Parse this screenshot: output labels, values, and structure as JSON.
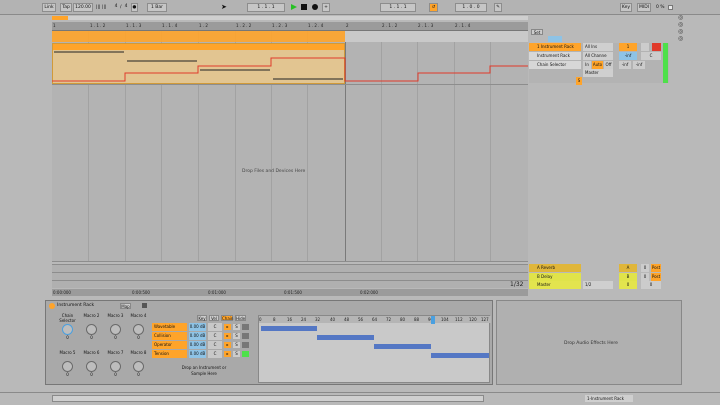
{
  "transport": {
    "link": "Link",
    "tap": "Tap",
    "tempo": "120.00",
    "sig_num": "4",
    "sig_den": "4",
    "quant": "1 Bar",
    "position": "1 . 1 . 1",
    "loop_start": "1 . 1 . 1",
    "loop_len": "1 . 0 . 0",
    "key": "Key",
    "midi": "MIDI",
    "cpu": "0 %"
  },
  "ruler": {
    "bars": [
      "1 . 1 . 2",
      "1 . 1 . 3",
      "1 . 1 . 4",
      "1 . 2",
      "1 . 2 . 2",
      "1 . 2 . 3",
      "1 . 2 . 4",
      "2",
      "2 . 1 . 2",
      "2 . 1 . 3",
      "2 . 1 . 4"
    ],
    "first": "1"
  },
  "time_ruler": [
    "0:00:000",
    "0:00:500",
    "0:01:000",
    "0:01:500",
    "0:02:000"
  ],
  "zoom_ratio": "1/32",
  "drop_text": "Drop Files and Devices Here",
  "tracks": [
    {
      "name": "1 Instrument Rack",
      "color": "#ffa42a",
      "input": "All Ins",
      "channel": "All Channe",
      "num": "1",
      "monitor_in": "In",
      "monitor_auto": "Auto",
      "monitor_off": "Off",
      "vol": "-inf",
      "pan": "C",
      "s": "S"
    },
    {
      "name": "Instrument Rack",
      "color": "#ffa42a"
    },
    {
      "name": "Chain Selector",
      "color": "#ffa42a",
      "output": "Master"
    }
  ],
  "returns": [
    {
      "name": "A Reverb",
      "color": "#e0b63a",
      "letter": "A",
      "vol": "0",
      "post": "Post"
    },
    {
      "name": "B Delay",
      "color": "#e0e34a",
      "letter": "B",
      "vol": "0",
      "post": "Post"
    },
    {
      "name": "Master",
      "color": "#e3e44e",
      "cue": "1/2",
      "vol": "0",
      "pan": "0"
    }
  ],
  "rack": {
    "title": "Instrument Rack",
    "map": "Map",
    "chain_selector": "Chain Selector",
    "chain_value": "0",
    "macros": [
      "Macro 2",
      "Macro 3",
      "Macro 4",
      "Macro 5",
      "Macro 6",
      "Macro 7",
      "Macro 8"
    ],
    "macro_value": "0",
    "header_buttons": [
      "Key",
      "Vel",
      "Chain",
      "Hide"
    ],
    "chains": [
      "Wavetable",
      "Collision",
      "Operator",
      "Tension"
    ],
    "chain_vol": "0.00 dB",
    "chain_pan": "C",
    "drop_instrument": "Drop an Instrument or Sample Here",
    "zone_labels": [
      "0",
      "8",
      "16",
      "24",
      "32",
      "40",
      "48",
      "56",
      "64",
      "72",
      "80",
      "88",
      "96",
      "104",
      "112",
      "120",
      "127"
    ]
  },
  "drop_effects": "Drop Audio Effects Here",
  "status": {
    "right_label": "1-Instrument Rack"
  },
  "colors": {
    "orange": "#ffa42a",
    "clip_bg": "#e8c88a",
    "red_line": "#e03a2a",
    "zone_blue": "#5477c4",
    "green_meter": "#4ee04a"
  }
}
